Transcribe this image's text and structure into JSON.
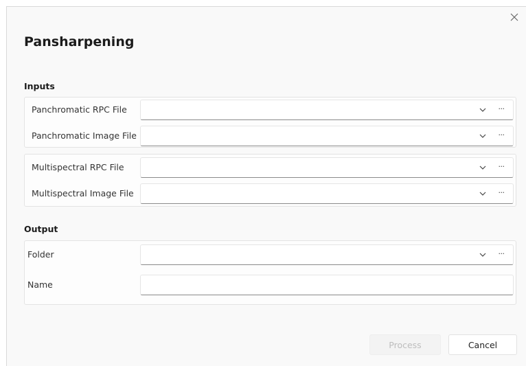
{
  "dialog": {
    "title": "Pansharpening",
    "close_glyph": "×"
  },
  "inputs": {
    "heading": "Inputs",
    "panchromatic_rpc": {
      "label": "Panchromatic RPC File",
      "value": ""
    },
    "panchromatic_image": {
      "label": "Panchromatic Image File",
      "value": ""
    },
    "multispectral_rpc": {
      "label": "Multispectral RPC File",
      "value": ""
    },
    "multispectral_image": {
      "label": "Multispectral Image File",
      "value": ""
    }
  },
  "output": {
    "heading": "Output",
    "folder": {
      "label": "Folder",
      "value": ""
    },
    "name": {
      "label": "Name",
      "value": ""
    }
  },
  "icons": {
    "dropdown": "chevron-down-icon",
    "browse": "more-dots-icon",
    "close": "close-icon"
  },
  "buttons": {
    "process": "Process",
    "cancel": "Cancel",
    "browse_glyph": "···"
  }
}
